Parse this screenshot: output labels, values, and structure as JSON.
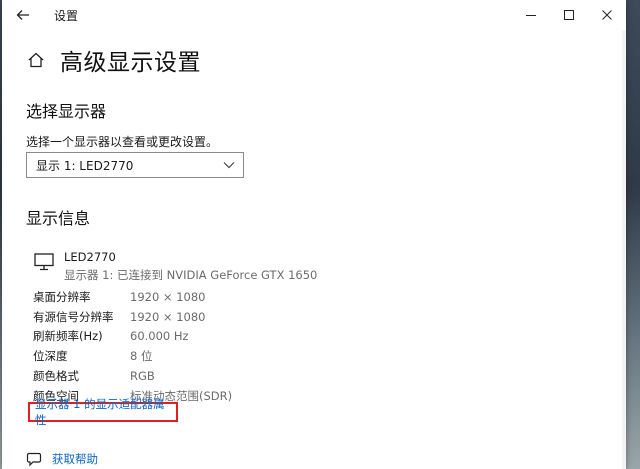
{
  "window": {
    "title": "设置"
  },
  "page": {
    "title": "高级显示设置"
  },
  "select_section": {
    "title": "选择显示器",
    "hint": "选择一个显示器以查看或更改设置。",
    "selected_display": "显示 1: LED2770"
  },
  "info_section": {
    "title": "显示信息",
    "monitor_name": "LED2770",
    "monitor_desc": "显示器 1: 已连接到 NVIDIA GeForce GTX 1650",
    "rows": [
      {
        "label": "桌面分辨率",
        "value": "1920 × 1080"
      },
      {
        "label": "有源信号分辨率",
        "value": "1920 × 1080"
      },
      {
        "label": "刷新频率(Hz)",
        "value": "60.000 Hz"
      },
      {
        "label": "位深度",
        "value": "8 位"
      },
      {
        "label": "颜色格式",
        "value": "RGB"
      },
      {
        "label": "颜色空间",
        "value": "标准动态范围(SDR)"
      }
    ],
    "adapter_link": "显示器 1 的显示适配器属性"
  },
  "help": {
    "label": "获取帮助"
  },
  "colors": {
    "link": "#0a66c2",
    "highlight_border": "#e02020"
  }
}
